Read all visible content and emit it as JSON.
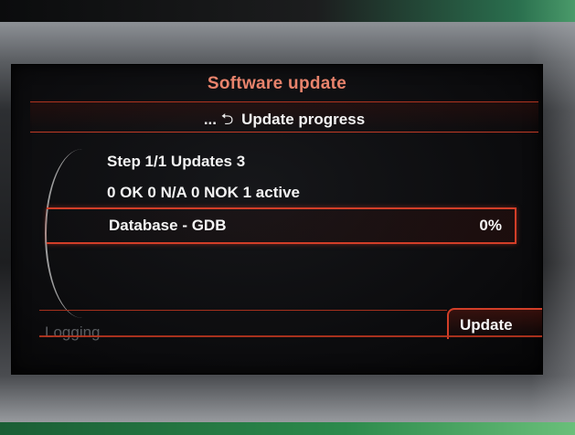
{
  "screen": {
    "title": "Software update",
    "subtitle": "Update progress",
    "subtitle_prefix": "...",
    "step_info": "Step 1/1 Updates 3",
    "status_info": "0 OK 0 N/A 0 NOK 1 active",
    "progress_item": {
      "label": "Database - GDB",
      "percent_text": "0%",
      "progress_fraction": 0.0
    },
    "softkeys": {
      "left_label": "Logging",
      "right_label": "Update"
    },
    "icons": {
      "back": "return-arrow-icon"
    }
  },
  "colors": {
    "accent_red": "#d23e28",
    "title_orange": "#e8836c",
    "text_white": "#f3f3f3",
    "inactive_gray": "#5a5c60"
  }
}
